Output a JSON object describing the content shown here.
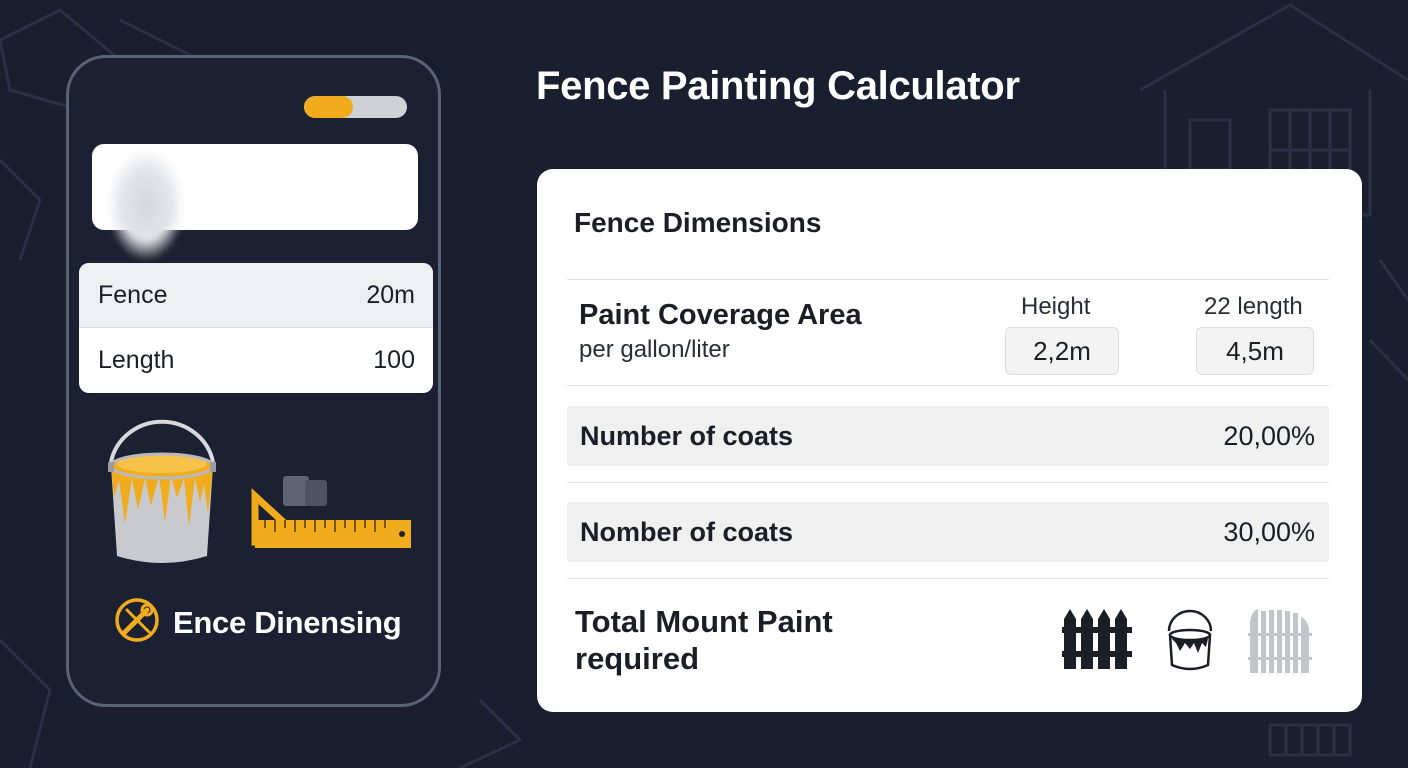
{
  "app": {
    "title": "Fence Painting Calculator"
  },
  "phone": {
    "progress_fraction": 0.48,
    "progress_color": "#f0ac1c",
    "list": [
      {
        "label": "Fence",
        "value": "20m"
      },
      {
        "label": "Length",
        "value": "100"
      }
    ],
    "footer_label": "Ence Dinensing",
    "icons": [
      "paint-bucket-icon",
      "ruler-icon",
      "tools-icon"
    ]
  },
  "card": {
    "heading": "Fence Dimensions",
    "coverage": {
      "title": "Paint Coverage Area",
      "subtitle": "per gallon/liter",
      "height_label": "Height",
      "height_value": "2,2m",
      "length_label": "22 length",
      "length_value": "4,5m"
    },
    "rows": [
      {
        "label": "Number of coats",
        "value": "20,00%"
      },
      {
        "label": "Nomber of coats",
        "value": "30,00%"
      }
    ],
    "total": {
      "label": "Total Mount Paint required",
      "icons": [
        "fence-icon",
        "paint-can-icon",
        "gate-icon"
      ]
    }
  },
  "colors": {
    "background": "#1a1f30",
    "accent": "#f0ac1c",
    "card": "#ffffff"
  }
}
